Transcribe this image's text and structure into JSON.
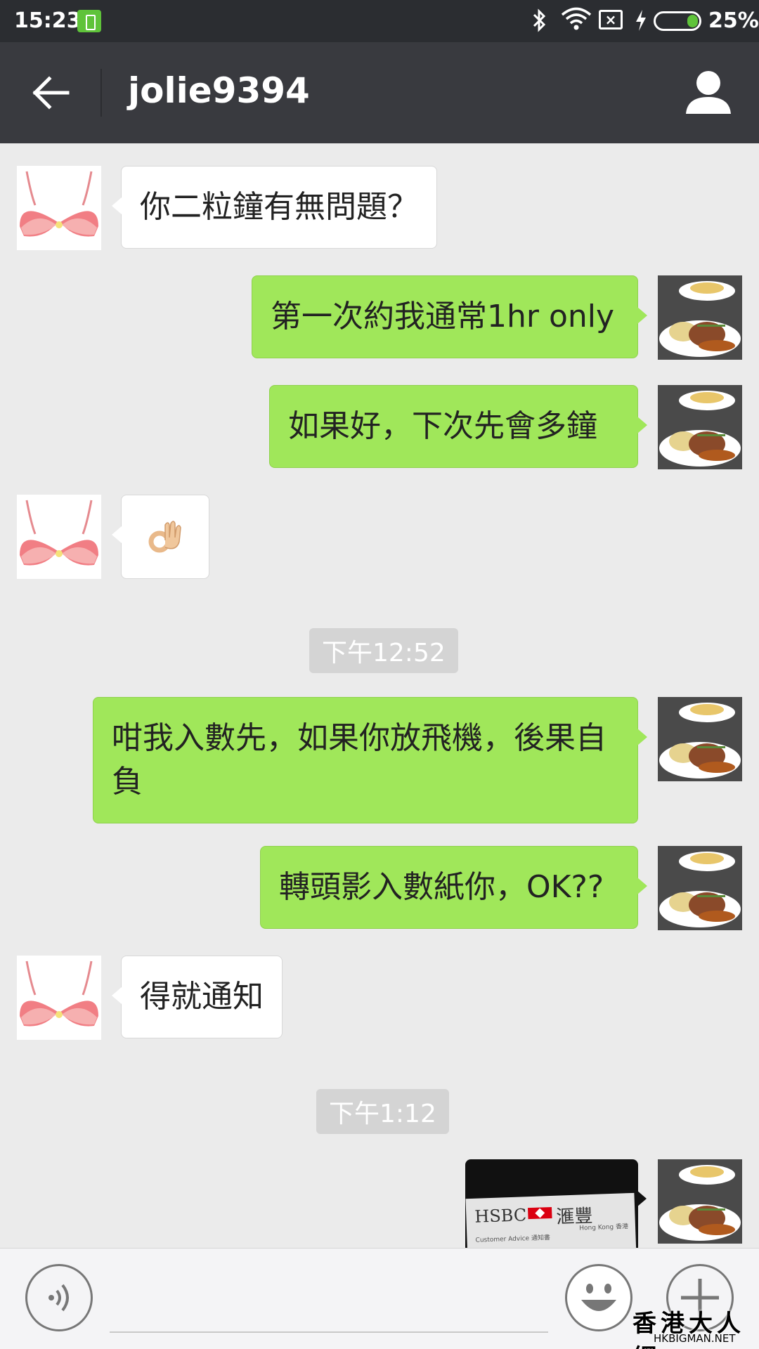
{
  "status_bar": {
    "time": "15:23",
    "battery_percent": "25%",
    "battery_level": 0.25
  },
  "header": {
    "title": "jolie9394"
  },
  "messages": [
    {
      "side": "in",
      "type": "text",
      "text": "你二粒鐘有無問題？"
    },
    {
      "side": "out",
      "type": "text",
      "text": "第一次約我通常1hr only"
    },
    {
      "side": "out",
      "type": "text",
      "text": "如果好，下次先會多鐘"
    },
    {
      "side": "in",
      "type": "emoji",
      "emoji": "ok-hand-emoji"
    },
    {
      "type": "timestamp",
      "text": "下午12:52"
    },
    {
      "side": "out",
      "type": "text",
      "text": "咁我入數先，如果你放飛機，後果自負"
    },
    {
      "side": "out",
      "type": "text",
      "text": "轉頭影入數紙你，OK??"
    },
    {
      "side": "in",
      "type": "text",
      "text": "得就通知"
    },
    {
      "type": "timestamp",
      "text": "下午1:12"
    },
    {
      "side": "out",
      "type": "image",
      "image_text": {
        "brand": "HSBC",
        "brand_cjk": "滙豐",
        "subtitle": "Customer Advice 通知書",
        "city": "Hong Kong 香港"
      }
    }
  ],
  "watermark": {
    "title": "香港大人網",
    "url": "HKBIGMAN.NET"
  },
  "colors": {
    "header_bg": "#393a3f",
    "status_bg": "#2b2d31",
    "chat_bg": "#ebebeb",
    "outgoing_bubble": "#a0e75a",
    "incoming_bubble": "#ffffff"
  }
}
